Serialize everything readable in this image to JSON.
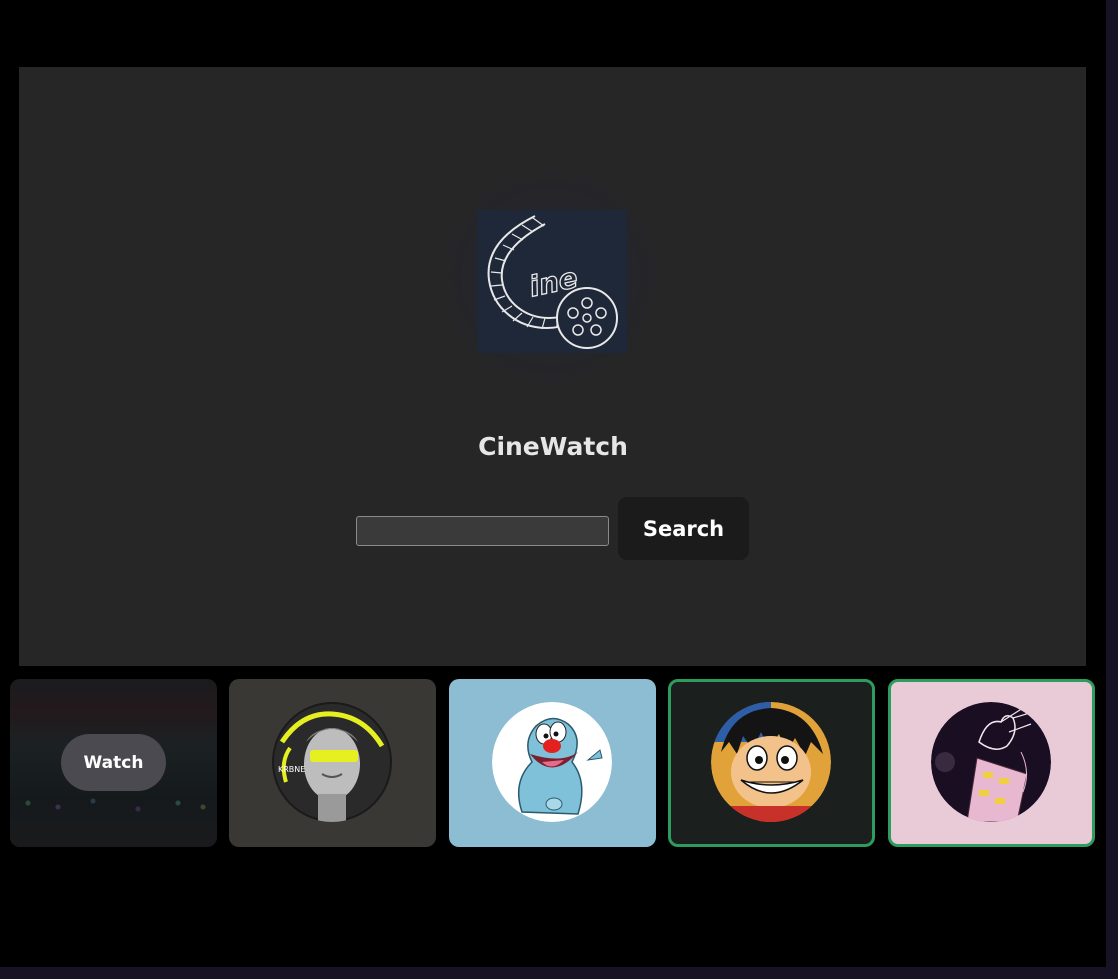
{
  "app": {
    "title": "CineWatch",
    "logo_icon": "cine-film-reel-logo",
    "logo_text": "ine"
  },
  "search": {
    "value": "",
    "placeholder": "",
    "button_label": "Search"
  },
  "profiles": [
    {
      "type": "watch-card",
      "button_label": "Watch",
      "selected": false
    },
    {
      "avatar": "statue-with-yellow-glasses-avatar",
      "selected": false
    },
    {
      "avatar": "oggy-blue-cat-avatar",
      "selected": false
    },
    {
      "avatar": "luffy-smiling-avatar",
      "selected": true
    },
    {
      "avatar": "hand-sketch-purple-avatar",
      "selected": true
    }
  ],
  "colors": {
    "hero_bg": "#262626",
    "page_bg": "#000000",
    "selected_border": "#2c9d5c"
  }
}
